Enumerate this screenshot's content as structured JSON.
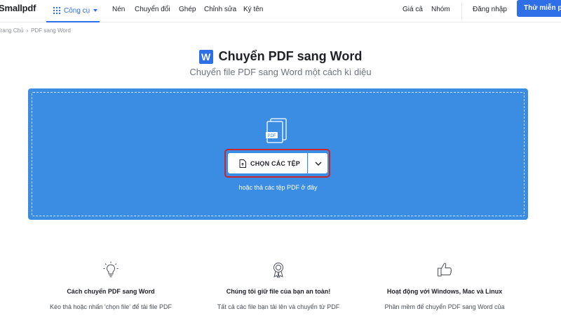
{
  "nav": {
    "logo": "Smallpdf",
    "tools_label": "Công cụ",
    "items": [
      "Nén",
      "Chuyển đổi",
      "Ghép",
      "Chỉnh sửa",
      "Ký tên"
    ],
    "pricing": "Giá cả",
    "teams": "Nhóm",
    "login": "Đăng nhập",
    "cta": "Thử miễn phí"
  },
  "breadcrumb": {
    "home": "Trang Chủ",
    "current": "PDF sang Word"
  },
  "hero": {
    "icon_letter": "W",
    "title": "Chuyển PDF sang Word",
    "subtitle": "Chuyển file PDF sang Word một cách kì diệu"
  },
  "dropzone": {
    "pdf_badge": "PDF",
    "choose_label": "CHỌN CÁC TỆP",
    "hint": "hoặc thả các tệp PDF ở đây"
  },
  "features": [
    {
      "icon": "lightbulb-icon",
      "title": "Cách chuyển PDF sang Word",
      "text": "Kéo thả hoặc nhấn 'chọn file' để tải file PDF"
    },
    {
      "icon": "award-icon",
      "title": "Chúng tôi giữ file của bạn an toàn!",
      "text": "Tất cả các file bạn tải lên và chuyển từ PDF"
    },
    {
      "icon": "thumbs-up-icon",
      "title": "Hoạt động với Windows, Mac và Linux",
      "text": "Phần mềm để chuyển PDF sang Word của"
    }
  ],
  "colors": {
    "accent": "#2e6ee6",
    "dropzone": "#3b8ce3",
    "highlight_border": "#c9252c"
  }
}
